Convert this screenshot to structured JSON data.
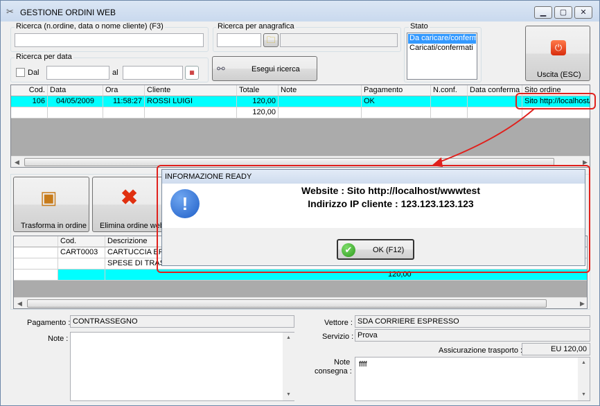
{
  "window": {
    "title": "GESTIONE ORDINI WEB"
  },
  "search": {
    "ricerca_label": "Ricerca (n.ordine, data o nome cliente) (F3)",
    "anagrafica_label": "Ricerca per anagrafica",
    "data_label": "Ricerca per data",
    "dal_label": "Dal",
    "al_label": "al",
    "esegui_label": "Esegui ricerca"
  },
  "stato": {
    "label": "Stato",
    "options": [
      "Da caricare/confermare",
      "Caricati/confermati"
    ],
    "selected": "Da caricare/confermare"
  },
  "exit_button": {
    "label": "Uscita (ESC)"
  },
  "orders_grid": {
    "columns": [
      "Cod.",
      "Data",
      "Ora",
      "Cliente",
      "Totale",
      "Note",
      "Pagamento",
      "N.conf.",
      "Data conferma",
      "Sito ordine"
    ],
    "rows": [
      [
        "106",
        "04/05/2009",
        "11:58:27",
        "ROSSI LUIGI",
        "120,00",
        "",
        "OK",
        "",
        "",
        "Sito http://localhost/wwwtest"
      ],
      [
        "",
        "",
        "",
        "",
        "120,00",
        "",
        "",
        "",
        "",
        ""
      ]
    ]
  },
  "actions": {
    "trasforma_label": "Trasforma in ordine",
    "elimina_label": "Elimina ordine web"
  },
  "items_grid": {
    "columns": [
      "",
      "Cod.",
      "Descrizione"
    ],
    "rows": [
      [
        "",
        "CART0003",
        "CARTUCCIA EPSON"
      ],
      [
        "",
        "",
        "SPESE DI TRASPORTO"
      ],
      [
        "",
        "",
        ""
      ]
    ],
    "total": "120,00"
  },
  "dialog": {
    "title": "INFORMAZIONE READY",
    "line1": "Website : Sito http://localhost/wwwtest",
    "line2": "Indirizzo IP cliente : 123.123.123.123",
    "ok_label": "OK (F12)"
  },
  "details": {
    "pagamento_label": "Pagamento :",
    "pagamento_value": "CONTRASSEGNO",
    "note_label": "Note :",
    "vettore_label": "Vettore :",
    "vettore_value": "SDA CORRIERE ESPRESSO",
    "servizio_label": "Servizio :",
    "servizio_value": "Prova",
    "assicurazione_label": "Assicurazione trasporto :",
    "assicurazione_value": "EU 120,00",
    "note_consegna_label_1": "Note",
    "note_consegna_label_2": "consegna :",
    "note_consegna_value": "ffff"
  },
  "colors": {
    "selected_row": "#00ffff",
    "highlight_red": "#e0201c",
    "title_bar": "#c9d9ee"
  }
}
